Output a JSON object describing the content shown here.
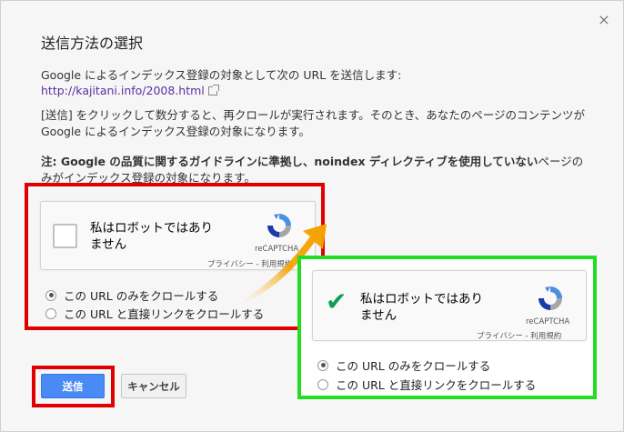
{
  "dialog": {
    "title": "送信方法の選択",
    "close_glyph": "×",
    "intro": "Google によるインデックス登録の対象として次の URL を送信します:",
    "url": "http://kajitani.info/2008.html",
    "description": "[送信] をクリックして数分すると、再クロールが実行されます。そのとき、あなたのページのコンテンツが Google によるインデックス登録の対象になります。",
    "note_bold": "注: Google の品質に関するガイドラインに準拠し、noindex ディレクティブを使用していない",
    "note_rest": "ページのみがインデックス登録の対象になります。"
  },
  "captcha_before": {
    "label_line1": "私はロボットではあり",
    "label_line2": "ません",
    "brand": "reCAPTCHA",
    "links": "プライバシー - 利用規約"
  },
  "captcha_after": {
    "label_line1": "私はロボットではあり",
    "label_line2": "ません",
    "brand": "reCAPTCHA",
    "links": "プライバシー - 利用規約",
    "check_glyph": "✔"
  },
  "options": [
    {
      "label": "この URL のみをクロールする",
      "selected": true
    },
    {
      "label": "この URL と直接リンクをクロールする",
      "selected": false
    }
  ],
  "buttons": {
    "send": "送信",
    "cancel": "キャンセル"
  },
  "colors": {
    "highlight_red": "#e00000",
    "highlight_green": "#22dd22",
    "primary_button": "#4a8af4",
    "arrow_orange": "#f5a000",
    "check_green": "#0f9d58"
  }
}
